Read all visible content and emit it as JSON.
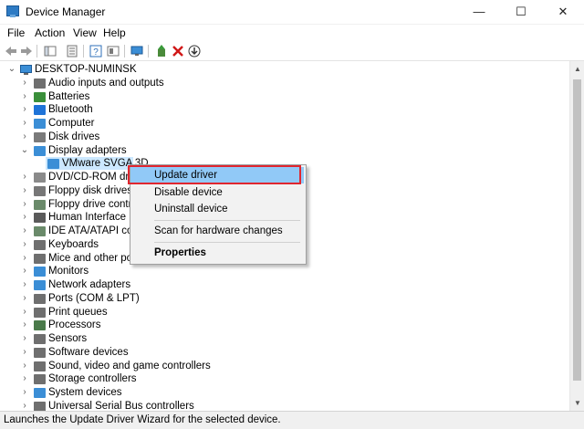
{
  "window": {
    "title": "Device Manager",
    "minimize": "—",
    "maximize": "☐",
    "close": "✕"
  },
  "menu": [
    "File",
    "Action",
    "View",
    "Help"
  ],
  "tree": {
    "root": "DESKTOP-NUMINSK",
    "items": [
      {
        "label": "Audio inputs and outputs",
        "expanded": false,
        "icon_color": "#6f6f6f"
      },
      {
        "label": "Batteries",
        "expanded": false,
        "icon_color": "#3a8f3a"
      },
      {
        "label": "Bluetooth",
        "expanded": false,
        "icon_color": "#1e73d8"
      },
      {
        "label": "Computer",
        "expanded": false,
        "icon_color": "#3b8ed6"
      },
      {
        "label": "Disk drives",
        "expanded": false,
        "icon_color": "#7a7a7a"
      },
      {
        "label": "Display adapters",
        "expanded": true,
        "icon_color": "#3b8ed6"
      },
      {
        "label": "DVD/CD-ROM drive",
        "expanded": false,
        "icon_color": "#8a8a8a"
      },
      {
        "label": "Floppy disk drives",
        "expanded": false,
        "icon_color": "#777777"
      },
      {
        "label": "Floppy drive control",
        "expanded": false,
        "icon_color": "#6a8a6a"
      },
      {
        "label": "Human Interface De",
        "expanded": false,
        "icon_color": "#5a5a5a"
      },
      {
        "label": "IDE ATA/ATAPI contr",
        "expanded": false,
        "icon_color": "#6a8a6a"
      },
      {
        "label": "Keyboards",
        "expanded": false,
        "icon_color": "#6f6f6f"
      },
      {
        "label": "Mice and other poin",
        "expanded": false,
        "icon_color": "#6f6f6f"
      },
      {
        "label": "Monitors",
        "expanded": false,
        "icon_color": "#3b8ed6"
      },
      {
        "label": "Network adapters",
        "expanded": false,
        "icon_color": "#3b8ed6"
      },
      {
        "label": "Ports (COM & LPT)",
        "expanded": false,
        "icon_color": "#6f6f6f"
      },
      {
        "label": "Print queues",
        "expanded": false,
        "icon_color": "#6f6f6f"
      },
      {
        "label": "Processors",
        "expanded": false,
        "icon_color": "#4a7a4a"
      },
      {
        "label": "Sensors",
        "expanded": false,
        "icon_color": "#6f6f6f"
      },
      {
        "label": "Software devices",
        "expanded": false,
        "icon_color": "#6f6f6f"
      },
      {
        "label": "Sound, video and game controllers",
        "expanded": false,
        "icon_color": "#6f6f6f"
      },
      {
        "label": "Storage controllers",
        "expanded": false,
        "icon_color": "#6f6f6f"
      },
      {
        "label": "System devices",
        "expanded": false,
        "icon_color": "#3b8ed6"
      },
      {
        "label": "Universal Serial Bus controllers",
        "expanded": false,
        "icon_color": "#6f6f6f"
      }
    ],
    "child": {
      "label": "VMware SVGA 3D",
      "parent": "Display adapters"
    }
  },
  "context_menu": {
    "items": [
      "Update driver",
      "Disable device",
      "Uninstall device",
      "Scan for hardware changes",
      "Properties"
    ],
    "highlighted": "Update driver"
  },
  "status": "Launches the Update Driver Wizard for the selected device.",
  "colors": {
    "highlight": "#91c9f7",
    "selection": "#cce8ff",
    "callout": "#e0262f"
  }
}
